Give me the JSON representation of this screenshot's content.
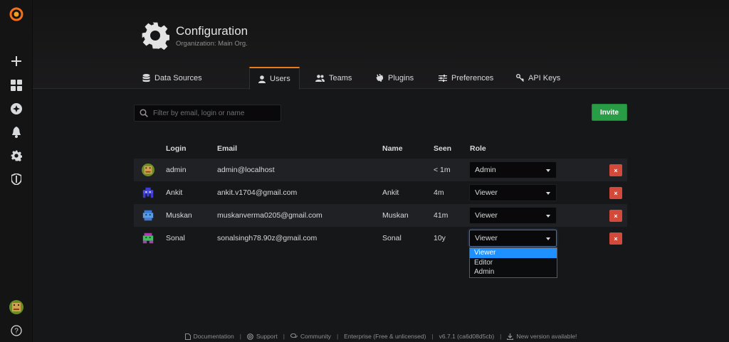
{
  "header": {
    "title": "Configuration",
    "subtitle": "Organization: Main Org.",
    "icon": "gear-icon"
  },
  "tabs": [
    {
      "label": "Data Sources",
      "icon": "database-icon",
      "active": false
    },
    {
      "label": "Users",
      "icon": "user-icon",
      "active": true
    },
    {
      "label": "Teams",
      "icon": "users-icon",
      "active": false
    },
    {
      "label": "Plugins",
      "icon": "plug-icon",
      "active": false
    },
    {
      "label": "Preferences",
      "icon": "sliders-icon",
      "active": false
    },
    {
      "label": "API Keys",
      "icon": "key-icon",
      "active": false
    }
  ],
  "search": {
    "placeholder": "Filter by email, login or name",
    "value": ""
  },
  "invite_label": "Invite",
  "table": {
    "headers": {
      "login": "Login",
      "email": "Email",
      "name": "Name",
      "seen": "Seen",
      "role": "Role"
    },
    "rows": [
      {
        "login": "admin",
        "email": "admin@localhost",
        "name": "",
        "seen": "< 1m",
        "role": "Admin"
      },
      {
        "login": "Ankit",
        "email": "ankit.v1704@gmail.com",
        "name": "Ankit",
        "seen": "4m",
        "role": "Viewer"
      },
      {
        "login": "Muskan",
        "email": "muskanverma0205@gmail.com",
        "name": "Muskan",
        "seen": "41m",
        "role": "Viewer"
      },
      {
        "login": "Sonal",
        "email": "sonalsingh78.90z@gmail.com",
        "name": "Sonal",
        "seen": "10y",
        "role": "Viewer"
      }
    ],
    "delete_label": "×"
  },
  "role_dropdown": {
    "options": [
      "Viewer",
      "Editor",
      "Admin"
    ],
    "selected": "Viewer"
  },
  "footer": {
    "documentation": "Documentation",
    "support": "Support",
    "community": "Community",
    "edition": "Enterprise (Free & unlicensed)",
    "version": "v6.7.1 (ca6d08d5cb)",
    "update": "New version available!",
    "sep": "|"
  },
  "colors": {
    "accent": "#eb7b18",
    "invite": "#299c46",
    "delete": "#d44a3a",
    "selected_option": "#1e90ff"
  }
}
